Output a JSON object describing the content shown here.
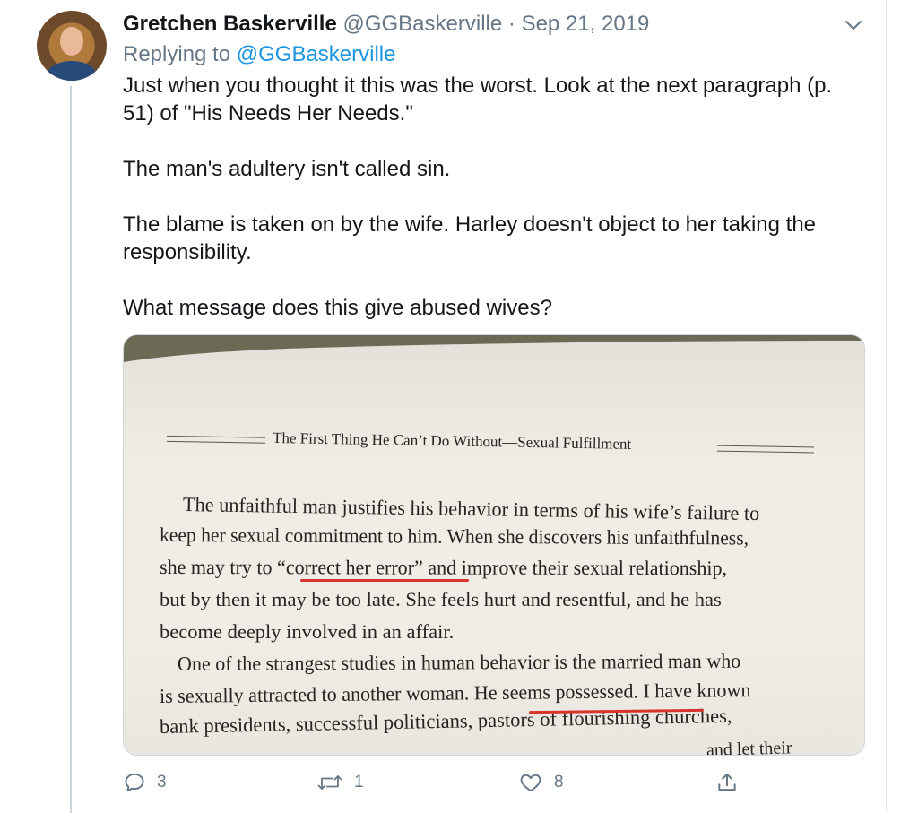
{
  "tweet": {
    "author_name": "Gretchen Baskerville",
    "author_handle": "@GGBaskerville",
    "separator": "·",
    "date": "Sep 21, 2019",
    "replying_prefix": "Replying to",
    "replying_to": "@GGBaskerville",
    "paragraphs": [
      "Just when you thought it this was the worst. Look at the next paragraph (p. 51) of \"His Needs Her Needs.\"",
      "The man's adultery isn't called sin.",
      "The blame is taken on by the wife. Harley doesn't object to her taking the responsibility.",
      "What message does this give abused wives?"
    ]
  },
  "image_text": {
    "running_head": "The First Thing He Can’t Do Without—Sexual Fulfillment",
    "lines": [
      "The unfaithful man justifies his behavior in terms of his wife’s failure to",
      "keep her sexual commitment to him. When she discovers his unfaithfulness,",
      "she may try to “correct her error” and improve their sexual relationship,",
      "but by then it may be too late. She feels hurt and resentful, and he has",
      "become deeply involved in an affair.",
      "One of the strangest studies in human behavior is the married man who",
      "is sexually attracted to another woman. He seems possessed. I have known",
      "bank presidents, successful politicians, pastors of flourishing churches,",
      "and let their"
    ],
    "underlined_phrases": [
      "correct her error",
      "He seems possessed"
    ]
  },
  "actions": {
    "reply_count": "3",
    "retweet_count": "1",
    "like_count": "8"
  },
  "colors": {
    "link": "#1b95e0",
    "secondary_text": "#657786",
    "underline_marker": "#d9342b"
  }
}
